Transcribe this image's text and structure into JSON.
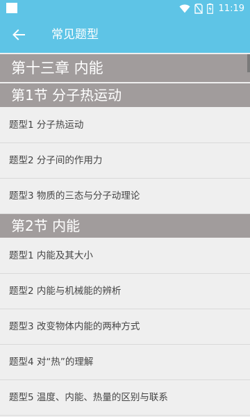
{
  "status_bar": {
    "time": "11:19"
  },
  "app_bar": {
    "title": "常见题型"
  },
  "chapter": {
    "title": "第十三章 内能"
  },
  "sections": [
    {
      "title": "第1节 分子热运动",
      "items": [
        "题型1 分子热运动",
        "题型2 分子间的作用力",
        "题型3 物质的三态与分子动理论"
      ]
    },
    {
      "title": "第2节 内能",
      "items": [
        "题型1 内能及其大小",
        "题型2 内能与机械能的辨析",
        "题型3 改变物体内能的两种方式",
        "题型4 对“热”的理解",
        "题型5 温度、内能、热量的区别与联系"
      ]
    }
  ]
}
